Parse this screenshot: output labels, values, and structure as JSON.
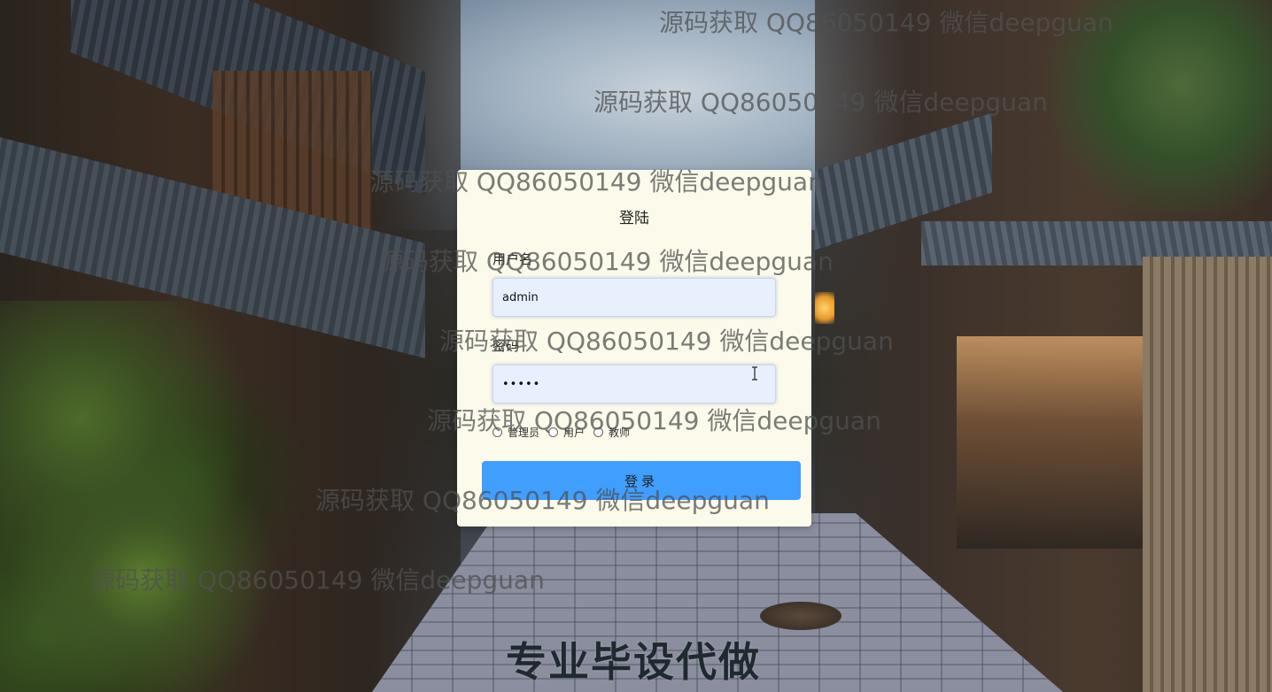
{
  "login": {
    "title": "登陆",
    "username_label": "用户名",
    "username_value": "admin",
    "password_label": "密码",
    "password_value": "12345",
    "roles": [
      {
        "label": "管理员"
      },
      {
        "label": "用户"
      },
      {
        "label": "教师"
      }
    ],
    "submit_label": "登录"
  },
  "watermarks": [
    "源码获取 QQ86050149 微信deepguan",
    "源码获取 QQ86050149 微信deepguan",
    "源码获取 QQ86050149 微信deepguan",
    "源码获取 QQ86050149 微信deepguan",
    "源码获取 QQ86050149 微信deepguan",
    "源码获取 QQ86050149 微信deepguan",
    "源码获取 QQ86050149 微信deepguan",
    "源码获取 QQ86050149 微信deepguan"
  ],
  "promo_text": "专业毕设代做",
  "colors": {
    "card_background": "#fcfaea",
    "input_background": "#e8f0fe",
    "button_background": "#409eff"
  }
}
